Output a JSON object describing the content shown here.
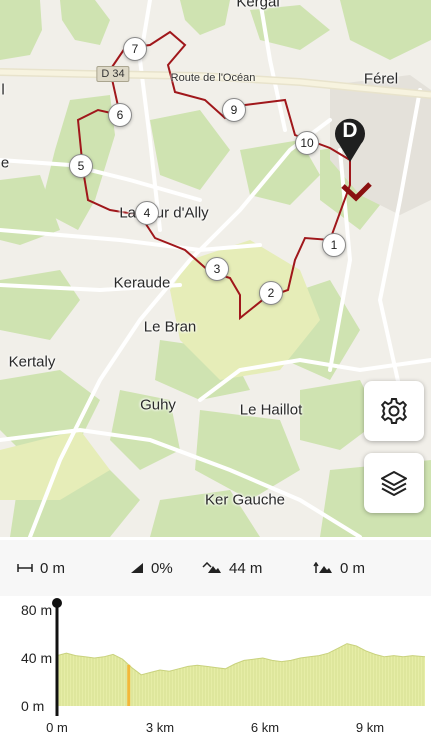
{
  "map": {
    "places": [
      {
        "name": "Kergal",
        "id": "kergal"
      },
      {
        "name": "Férel",
        "id": "ferel"
      },
      {
        "name": "La Tour d'Ally",
        "id": "la-tour-d-ally"
      },
      {
        "name": "Keraude",
        "id": "keraude"
      },
      {
        "name": "Le Bran",
        "id": "le-bran"
      },
      {
        "name": "Kertaly",
        "id": "kertaly"
      },
      {
        "name": "Guhy",
        "id": "guhy"
      },
      {
        "name": "Le Haillot",
        "id": "le-haillot"
      },
      {
        "name": "Ker Gauche",
        "id": "ker-gauche"
      },
      {
        "name": "e",
        "id": "edge-e"
      },
      {
        "name": "l",
        "id": "edge-l"
      }
    ],
    "road_label": "Route de l'Océan",
    "road_shield": "D 34",
    "waypoints": [
      "1",
      "2",
      "3",
      "4",
      "5",
      "6",
      "7",
      "9",
      "10"
    ],
    "start_marker": "D",
    "route_color": "#a0171b"
  },
  "buttons": {
    "settings_icon": "gear-icon",
    "layers_icon": "layers-icon"
  },
  "stats": {
    "distance": "0 m",
    "grade": "0%",
    "ascent": "44 m",
    "descent": "0 m"
  },
  "chart_data": {
    "type": "area",
    "title": "",
    "xlabel": "",
    "ylabel": "",
    "x_unit": "km",
    "y_unit": "m",
    "xlim": [
      0,
      11.8
    ],
    "ylim": [
      0,
      80
    ],
    "x_ticks": [
      "0 m",
      "3 km",
      "6 km",
      "9 km"
    ],
    "y_ticks": [
      "80 m",
      "40 m",
      "0 m"
    ],
    "cursor_x": 0,
    "highlight_x": 2.3,
    "fill_color": "#e6eda6",
    "series": [
      {
        "x": [
          0,
          0.3,
          0.6,
          0.9,
          1.2,
          1.5,
          1.8,
          2.1,
          2.4,
          2.7,
          3.0,
          3.3,
          3.6,
          3.9,
          4.2,
          4.5,
          4.8,
          5.1,
          5.4,
          5.7,
          6.0,
          6.3,
          6.6,
          6.9,
          7.2,
          7.5,
          7.8,
          8.1,
          8.4,
          8.7,
          9.0,
          9.3,
          9.6,
          9.9,
          10.2,
          10.5,
          10.8,
          11.1,
          11.4,
          11.8
        ],
        "y": [
          42,
          44,
          42,
          41,
          40,
          41,
          43,
          39,
          32,
          26,
          28,
          30,
          29,
          31,
          33,
          34,
          33,
          32,
          31,
          35,
          38,
          39,
          40,
          38,
          37,
          38,
          40,
          41,
          42,
          44,
          48,
          52,
          50,
          46,
          43,
          41,
          42,
          41,
          42,
          41
        ]
      }
    ]
  }
}
